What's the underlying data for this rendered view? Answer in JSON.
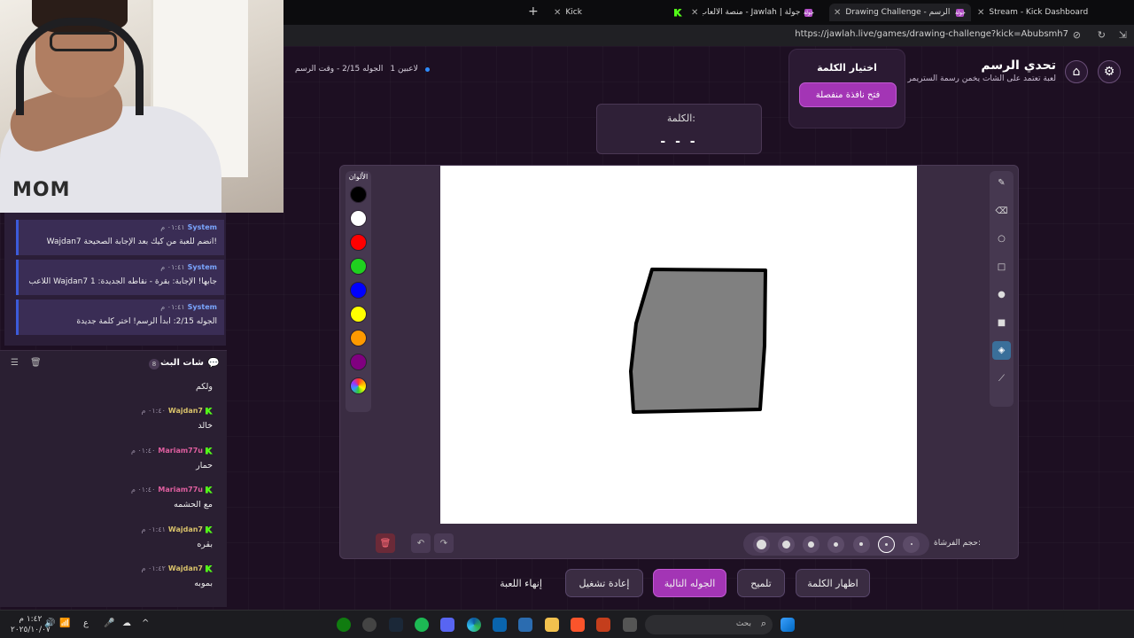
{
  "browser": {
    "tabs": [
      {
        "label": "Kick",
        "favicon": "kick-icon"
      },
      {
        "label": "جولة | Jawlah - منصة الألعاب التفاعلية",
        "favicon": "jawlah-icon"
      },
      {
        "label": "Drawing Challenge - تحدي الرسم",
        "favicon": "jawlah-icon",
        "active": true
      },
      {
        "label": "Stream - Kick Dashboard",
        "favicon": "kick-icon"
      }
    ],
    "favicon_text": "جولة",
    "url": "https://jawlah.live/games/drawing-challenge?kick=Abubsmh7"
  },
  "header": {
    "title": "تحدي الرسم",
    "subtitle": "لعبة تعتمد على الشات يخمن رسمة الستريمر",
    "players": "1 لاعبين",
    "round_info": "الجوله 2/15 - وقت الرسم"
  },
  "word_popup": {
    "title": "اختيار الكلمة",
    "button": "فتح نافذة منفصلة"
  },
  "word_box": {
    "label": "الكلمة:",
    "masked": "- - -"
  },
  "palette": {
    "title": "الألوان",
    "colors": [
      "#000000",
      "#ffffff",
      "#ff0000",
      "#00cc00",
      "#0000ff",
      "#ffff00",
      "#ff9900",
      "#800080"
    ]
  },
  "brush": {
    "label": "حجم الفرشاة:"
  },
  "actions": {
    "show_word": "اظهار الكلمة",
    "hint": "تلميح",
    "next_round": "الجوله التالية",
    "restart": "إعادة تشغيل",
    "end_game": "إنهاء اللعبة"
  },
  "system_messages": [
    {
      "author": "System",
      "time": "٠١:٤١ م",
      "text": "Wajdan7 انضم للعبة من كيك بعد الإجابة الصحيحة!"
    },
    {
      "author": "System",
      "time": "٠١:٤١ م",
      "text": "اللاعب Wajdan7 جابها! الإجابة: بقرة - نقاطه الجديدة: 1"
    },
    {
      "author": "System",
      "time": "٠١:٤١ م",
      "text": "الجوله 2/15: ابدأ الرسم! اختر كلمة جديدة"
    }
  ],
  "chat": {
    "title": "شات البث",
    "count": "8",
    "messages": [
      {
        "author": "",
        "time": "",
        "text": "ولكم"
      },
      {
        "author": "Wajdan7",
        "time": "٠١:٤٠ م",
        "text": "خالد",
        "color": "#53fc18"
      },
      {
        "author": "Mariam77u",
        "time": "٠١:٤٠ م",
        "text": "حمار",
        "color": "#e05fa0"
      },
      {
        "author": "Mariam77u",
        "time": "٠١:٤٠ م",
        "text": "مع الحشمه",
        "color": "#e05fa0"
      },
      {
        "author": "Wajdan7",
        "time": "٠١:٤١ م",
        "text": "بقره",
        "color": "#53fc18"
      },
      {
        "author": "Wajdan7",
        "time": "٠١:٤٢ م",
        "text": "بموبه",
        "color": "#53fc18"
      }
    ]
  },
  "taskbar": {
    "search_placeholder": "بحث",
    "clock_time": "١:٤٢ م",
    "clock_date": "٢٠٢٥/١٠/٠٧",
    "lang": "ع"
  },
  "colors": {
    "accent": "#a335b5",
    "background": "#1d0f22",
    "kick_green": "#53fc18"
  }
}
